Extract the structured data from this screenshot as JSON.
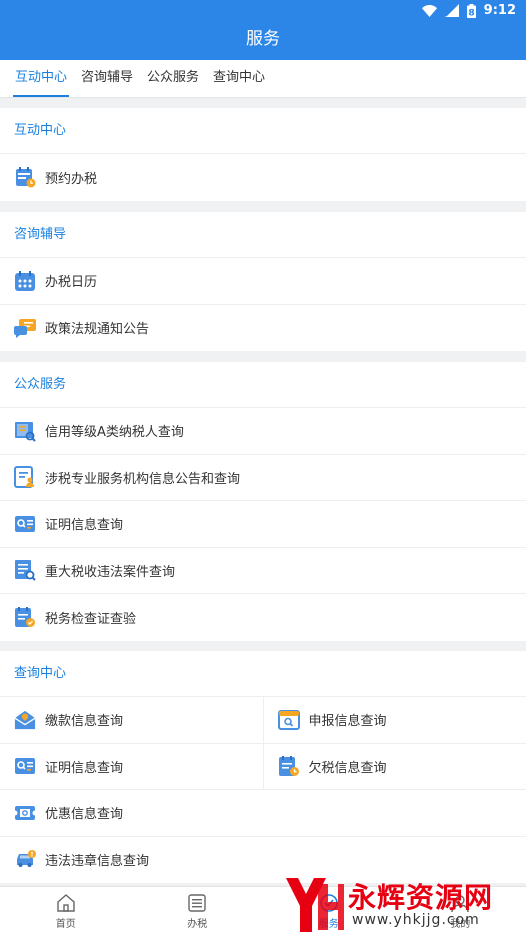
{
  "status": {
    "time": "9:12",
    "battery": "8"
  },
  "title": "服务",
  "tabs": [
    "互动中心",
    "咨询辅导",
    "公众服务",
    "查询中心"
  ],
  "sections": [
    {
      "header": "互动中心",
      "items": [
        {
          "label": "预约办税",
          "icon": "calendar-clock-icon"
        }
      ]
    },
    {
      "header": "咨询辅导",
      "items": [
        {
          "label": "办税日历",
          "icon": "calendar-icon"
        },
        {
          "label": "政策法规通知公告",
          "icon": "chat-bubble-icon"
        }
      ]
    },
    {
      "header": "公众服务",
      "items": [
        {
          "label": "信用等级A类纳税人查询",
          "icon": "credit-search-icon"
        },
        {
          "label": "涉税专业服务机构信息公告和查询",
          "icon": "agency-doc-icon"
        },
        {
          "label": "证明信息查询",
          "icon": "certificate-search-icon"
        },
        {
          "label": "重大税收违法案件查询",
          "icon": "case-search-icon"
        },
        {
          "label": "税务检查证查验",
          "icon": "inspection-cert-icon"
        }
      ]
    },
    {
      "header": "查询中心",
      "grid": [
        [
          "缴款信息查询",
          "申报信息查询"
        ],
        [
          "证明信息查询",
          "欠税信息查询"
        ]
      ],
      "items": [
        {
          "label": "优惠信息查询",
          "icon": "discount-ticket-icon"
        },
        {
          "label": "违法违章信息查询",
          "icon": "car-violation-icon"
        }
      ]
    }
  ],
  "bottom_nav": [
    "首页",
    "办税",
    "服务",
    "我的"
  ],
  "watermark": {
    "text": "永辉资源网",
    "url": "www.yhkjjg.com"
  },
  "colors": {
    "primary": "#2b86e8",
    "accent": "#1a80e0",
    "orange": "#f5a623"
  }
}
